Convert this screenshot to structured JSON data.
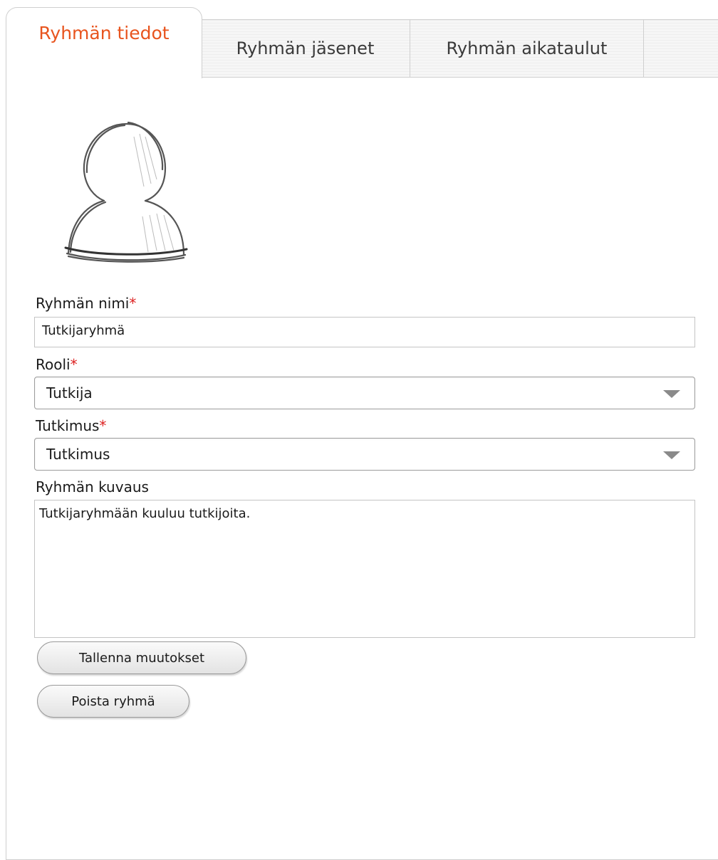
{
  "tabs": {
    "active": "Ryhmän tiedot",
    "members": "Ryhmän jäsenet",
    "schedules": "Ryhmän aikataulut"
  },
  "avatar_icon": "user-silhouette-icon",
  "form": {
    "name_label": "Ryhmän nimi",
    "name_value": "Tutkijaryhmä",
    "role_label": "Rooli",
    "role_value": "Tutkija",
    "study_label": "Tutkimus",
    "study_value": "Tutkimus",
    "description_label": "Ryhmän kuvaus",
    "description_value": "Tutkijaryhmään kuuluu tutkijoita.",
    "required_mark": "*"
  },
  "buttons": {
    "save": "Tallenna muutokset",
    "delete": "Poista ryhmä"
  },
  "colors": {
    "active_tab": "#e8541e",
    "required": "#dd2222"
  }
}
